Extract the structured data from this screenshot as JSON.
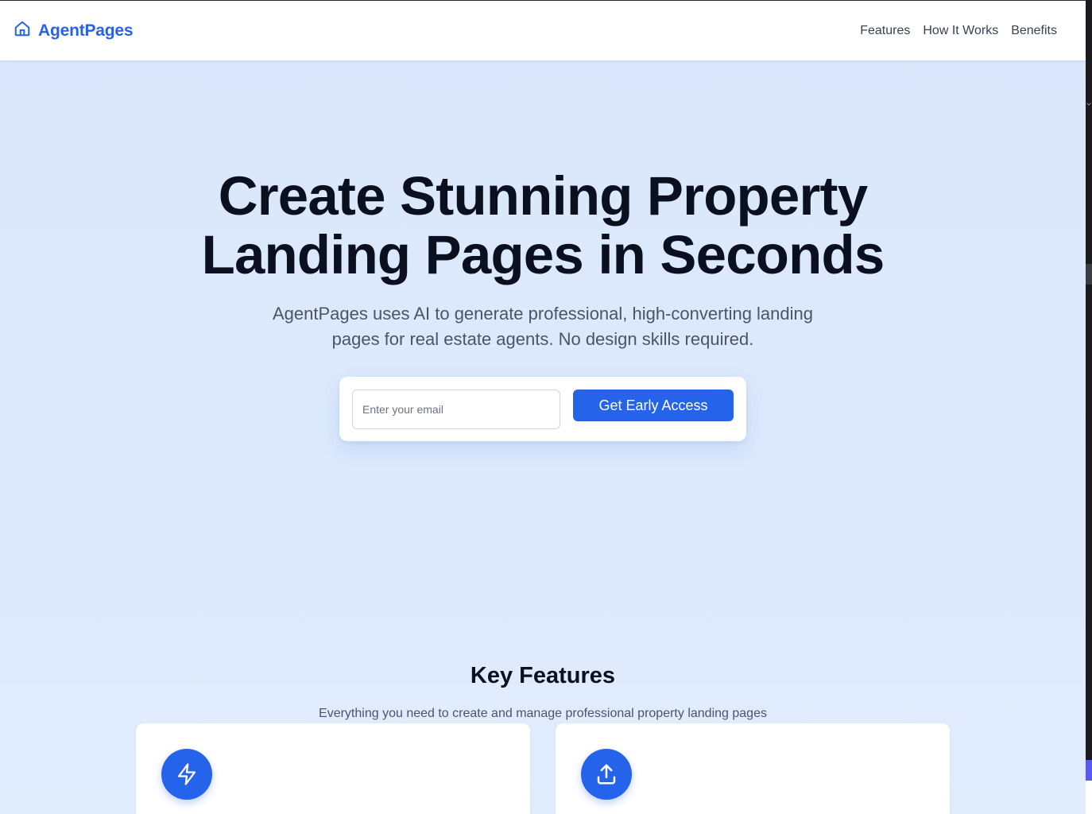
{
  "header": {
    "brand_name": "AgentPages",
    "brand_icon": "home-icon",
    "nav": [
      {
        "label": "Features"
      },
      {
        "label": "How It Works"
      },
      {
        "label": "Benefits"
      }
    ]
  },
  "hero": {
    "title_line1": "Create Stunning Property",
    "title_line2": "Landing Pages in Seconds",
    "subtitle_line1": "AgentPages uses AI to generate professional, high-converting landing",
    "subtitle_line2": "pages for real estate agents. No design skills required.",
    "email_placeholder": "Enter your email",
    "email_value": "",
    "cta_label": "Get Early Access"
  },
  "features": {
    "title": "Key Features",
    "subtitle": "Everything you need to create and manage professional property landing pages",
    "cards": [
      {
        "icon": "lightning-icon"
      },
      {
        "icon": "upload-icon"
      }
    ]
  },
  "colors": {
    "accent": "#2563eb",
    "background": "#dbe8fc",
    "heading": "#0b1020",
    "body_text": "#4b5563"
  }
}
